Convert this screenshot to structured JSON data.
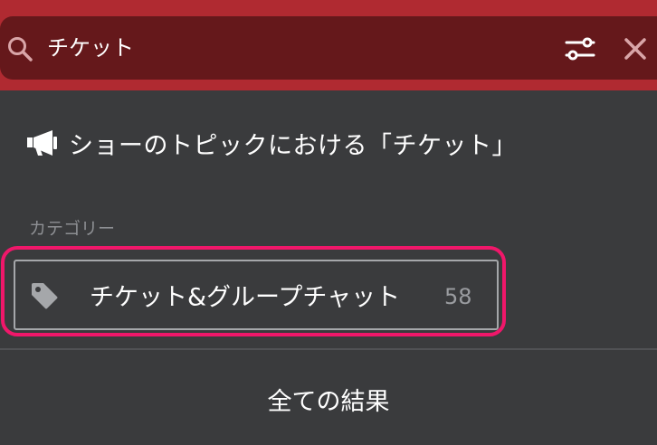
{
  "search": {
    "query": "チケット"
  },
  "icons": {
    "search": "search-icon",
    "filter": "filter-sliders-icon",
    "close": "close-icon",
    "topic": "megaphone-icon",
    "category": "tag-icon"
  },
  "suggestion": {
    "topic_text": "ショーのトピックにおける「チケット」"
  },
  "categories": {
    "section_label": "カテゴリー",
    "items": [
      {
        "name": "チケット&グループチャット",
        "count": "58"
      }
    ]
  },
  "footer": {
    "all_results_label": "全ての結果"
  },
  "colors": {
    "header_bg": "#b02a31",
    "search_bg": "#65181b",
    "panel_bg": "#3a3b3d",
    "highlight": "#f0176a"
  }
}
